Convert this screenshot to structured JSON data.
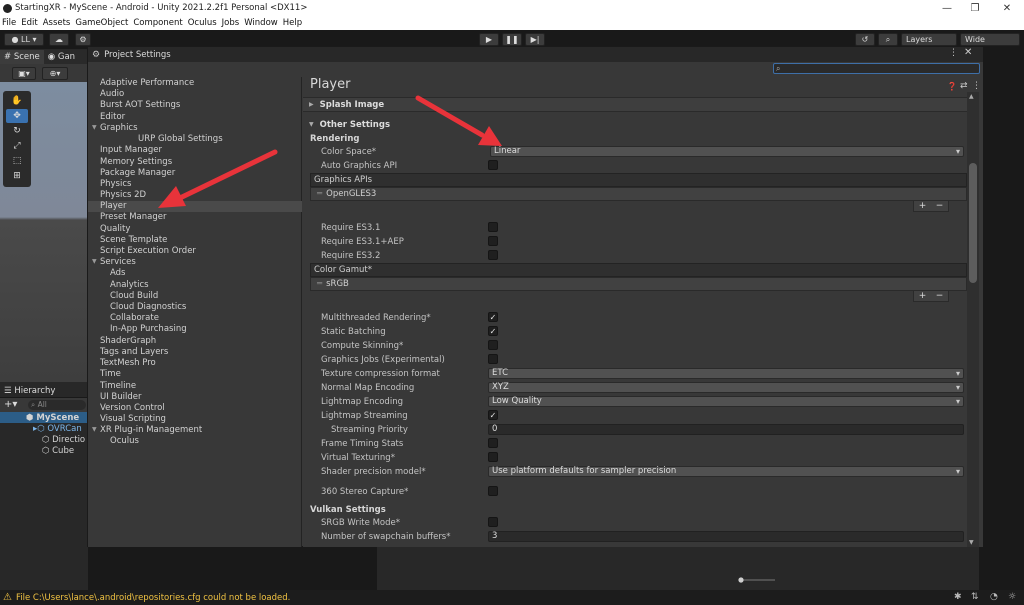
{
  "window": {
    "title": "StartingXR - MyScene - Android - Unity 2021.2.2f1 Personal <DX11>"
  },
  "menu": [
    "File",
    "Edit",
    "Assets",
    "GameObject",
    "Component",
    "Oculus",
    "Jobs",
    "Window",
    "Help"
  ],
  "toolbar": {
    "account": "LL",
    "layers": "Layers",
    "layout": "Wide"
  },
  "scene_tabs": {
    "scene": "Scene",
    "game": "Gan"
  },
  "hierarchy": {
    "tab": "Hierarchy",
    "search_placeholder": "All",
    "items": [
      "MyScene",
      "OVRCan",
      "Directio",
      "Cube"
    ]
  },
  "project_settings": {
    "title": "Project Settings",
    "nav": [
      "Adaptive Performance",
      "Audio",
      "Burst AOT Settings",
      "Editor",
      "Graphics",
      "URP Global Settings",
      "Input Manager",
      "Memory Settings",
      "Package Manager",
      "Physics",
      "Physics 2D",
      "Player",
      "Preset Manager",
      "Quality",
      "Scene Template",
      "Script Execution Order",
      "Services",
      "Ads",
      "Analytics",
      "Cloud Build",
      "Cloud Diagnostics",
      "Collaborate",
      "In-App Purchasing",
      "ShaderGraph",
      "Tags and Layers",
      "TextMesh Pro",
      "Time",
      "Timeline",
      "UI Builder",
      "Version Control",
      "Visual Scripting",
      "XR Plug-in Management",
      "Oculus"
    ],
    "selected": "Player"
  },
  "player": {
    "title": "Player",
    "splash": "Splash Image",
    "other": "Other Settings",
    "rendering": "Rendering",
    "color_space_label": "Color Space*",
    "color_space_value": "Linear",
    "auto_graphics": "Auto Graphics API",
    "graphics_apis": "Graphics APIs",
    "opengles": "OpenGLES3",
    "req31": "Require ES3.1",
    "req31aep": "Require ES3.1+AEP",
    "req32": "Require ES3.2",
    "color_gamut": "Color Gamut*",
    "srgb": "sRGB",
    "multithreaded": "Multithreaded Rendering*",
    "static_batching": "Static Batching",
    "compute_skinning": "Compute Skinning*",
    "graphics_jobs": "Graphics Jobs (Experimental)",
    "texture_compression": "Texture compression format",
    "texture_compression_value": "ETC",
    "normal_map": "Normal Map Encoding",
    "normal_map_value": "XYZ",
    "lightmap_encoding": "Lightmap Encoding",
    "lightmap_encoding_value": "Low Quality",
    "lightmap_streaming": "Lightmap Streaming",
    "streaming_priority": "Streaming Priority",
    "streaming_priority_value": "0",
    "frame_timing": "Frame Timing Stats",
    "virtual_texturing": "Virtual Texturing*",
    "shader_precision": "Shader precision model*",
    "shader_precision_value": "Use platform defaults for sampler precision",
    "stereo_capture": "360 Stereo Capture*",
    "vulkan": "Vulkan Settings",
    "srgb_write": "SRGB Write Mode*",
    "swapchain": "Number of swapchain buffers*",
    "swapchain_value": "3"
  },
  "status": {
    "message": "File C:\\Users\\lance\\.android\\repositories.cfg could not be loaded."
  },
  "colors": {
    "accent": "#3a72b0",
    "arrow": "#e8333a",
    "warning": "#f1c343"
  }
}
